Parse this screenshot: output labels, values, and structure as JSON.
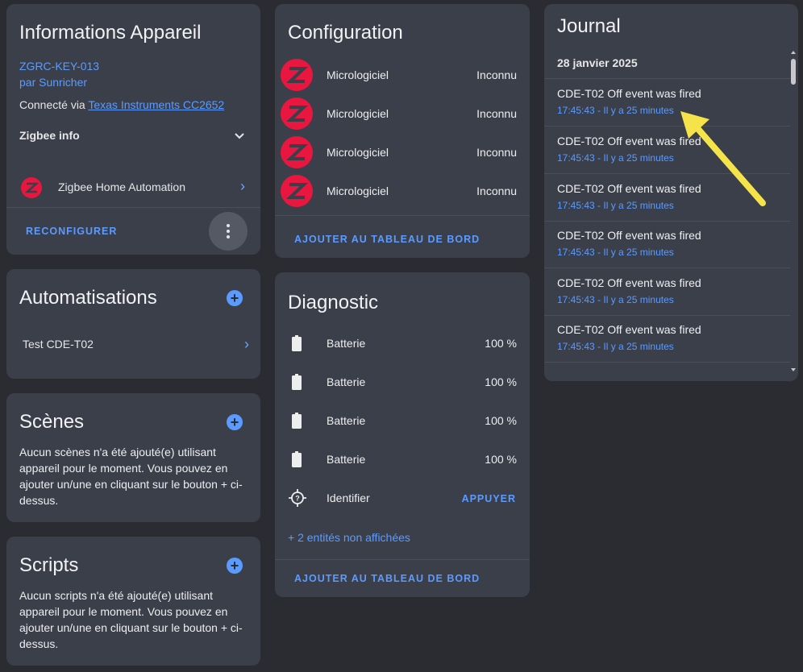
{
  "device_info": {
    "title": "Informations Appareil",
    "model": "ZGRC-KEY-013",
    "manufacturer": "par Sunricher",
    "connected_prefix": "Connecté via",
    "connected_link": "Texas Instruments CC2652",
    "zigbee_info": "Zigbee info",
    "integration": "Zigbee Home Automation",
    "reconfigure": "RECONFIGURER"
  },
  "automations": {
    "title": "Automatisations",
    "items": [
      "Test CDE-T02"
    ]
  },
  "scenes": {
    "title": "Scènes",
    "description": "Aucun scènes n'a été ajouté(e) utilisant appareil pour le moment. Vous pouvez en ajouter un/une en cliquant sur le bouton + ci-dessus."
  },
  "scripts": {
    "title": "Scripts",
    "description": "Aucun scripts n'a été ajouté(e) utilisant appareil pour le moment. Vous pouvez en ajouter un/une en cliquant sur le bouton + ci-dessus."
  },
  "configuration": {
    "title": "Configuration",
    "rows": [
      {
        "label": "Micrologiciel",
        "value": "Inconnu"
      },
      {
        "label": "Micrologiciel",
        "value": "Inconnu"
      },
      {
        "label": "Micrologiciel",
        "value": "Inconnu"
      },
      {
        "label": "Micrologiciel",
        "value": "Inconnu"
      }
    ],
    "add_to_dashboard": "AJOUTER AU TABLEAU DE BORD"
  },
  "diagnostic": {
    "title": "Diagnostic",
    "rows": [
      {
        "label": "Batterie",
        "value": "100 %"
      },
      {
        "label": "Batterie",
        "value": "100 %"
      },
      {
        "label": "Batterie",
        "value": "100 %"
      },
      {
        "label": "Batterie",
        "value": "100 %"
      }
    ],
    "identify_label": "Identifier",
    "identify_action": "APPUYER",
    "hidden_entities": "+ 2 entités non affichées",
    "add_to_dashboard": "AJOUTER AU TABLEAU DE BORD"
  },
  "journal": {
    "title": "Journal",
    "date": "28 janvier 2025",
    "entries": [
      {
        "title": "CDE-T02 Off event was fired",
        "time": "17:45:43 - Il y a 25 minutes"
      },
      {
        "title": "CDE-T02 Off event was fired",
        "time": "17:45:43 - Il y a 25 minutes"
      },
      {
        "title": "CDE-T02 Off event was fired",
        "time": "17:45:43 - Il y a 25 minutes"
      },
      {
        "title": "CDE-T02 Off event was fired",
        "time": "17:45:43 - Il y a 25 minutes"
      },
      {
        "title": "CDE-T02 Off event was fired",
        "time": "17:45:43 - Il y a 25 minutes"
      },
      {
        "title": "CDE-T02 Off event was fired",
        "time": "17:45:43 - Il y a 25 minutes"
      }
    ]
  },
  "colors": {
    "accent": "#5b9bff",
    "card": "#3b3f4a",
    "background": "#2b2c31",
    "zigbee_red": "#e8173f",
    "annotation_arrow": "#f5e34a"
  }
}
